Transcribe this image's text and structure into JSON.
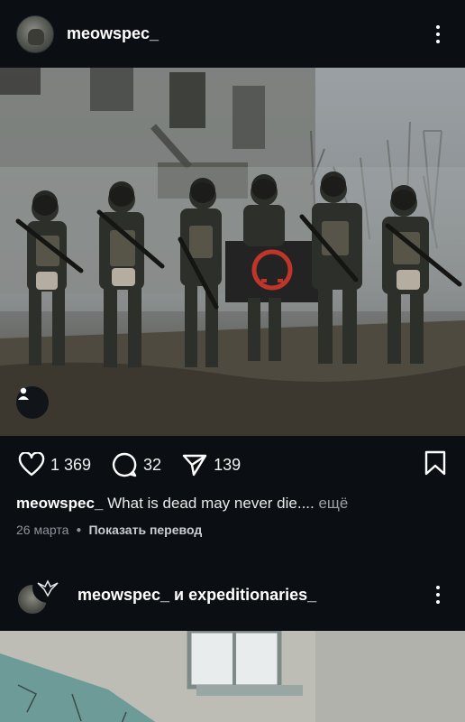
{
  "post1": {
    "username": "meowspec_",
    "likes": "1 369",
    "comments": "32",
    "shares": "139",
    "caption_user": "meowspec_",
    "caption_text": "What is dead may never die....",
    "caption_more": "ещё",
    "date": "26 марта",
    "translate": "Показать перевод",
    "icons": [
      "heart-icon",
      "comment-icon",
      "share-icon",
      "bookmark-icon",
      "more-icon",
      "user-tag-icon"
    ]
  },
  "post2": {
    "username": "meowspec_ и expeditionaries_"
  },
  "colors": {
    "background": "#0b0f14",
    "text": "#f2f2f2",
    "muted": "#8e949b",
    "flag_emblem": "#c0352a"
  }
}
